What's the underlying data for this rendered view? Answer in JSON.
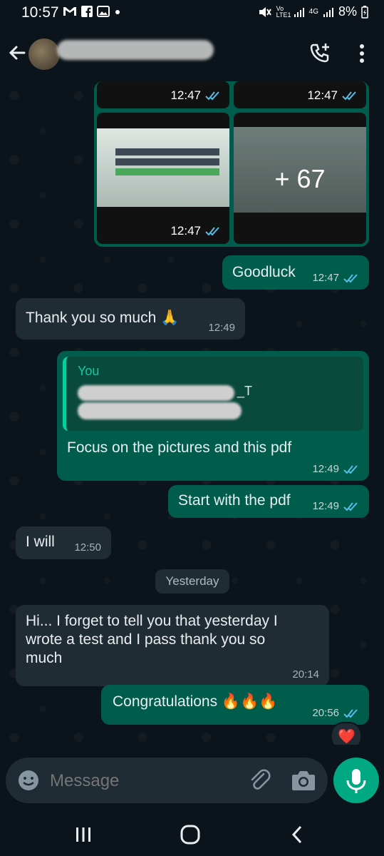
{
  "status_bar": {
    "time": "10:57",
    "network_labels": "Vo LTE1",
    "network_type": "4G",
    "battery": "8%"
  },
  "header": {
    "contact_name": "",
    "icons": [
      "back-arrow-icon",
      "avatar",
      "add-call-icon",
      "more-vert-icon"
    ]
  },
  "album": {
    "times": [
      "12:47",
      "12:47",
      "12:47"
    ],
    "more_count": "+ 67"
  },
  "messages": [
    {
      "id": "goodluck",
      "direction": "out",
      "text": "Goodluck",
      "time": "12:47"
    },
    {
      "id": "thanks",
      "direction": "in",
      "text": "Thank you so much 🙏",
      "time": "12:49"
    },
    {
      "id": "focus",
      "direction": "out",
      "quote_author": "You",
      "quote_tail": "_T",
      "text": "Focus on the pictures and this pdf",
      "time": "12:49"
    },
    {
      "id": "start",
      "direction": "out",
      "text": "Start with the pdf",
      "time": "12:49"
    },
    {
      "id": "iwill",
      "direction": "in",
      "text": "I will",
      "time": "12:50"
    },
    {
      "id": "forget",
      "direction": "in",
      "text": "Hi... I forget to tell you that yesterday I wrote a test and I pass  thank you so much",
      "time": "20:14"
    },
    {
      "id": "congrats",
      "direction": "out",
      "text": "Congratulations 🔥🔥🔥",
      "time": "20:56",
      "reaction": "❤️"
    }
  ],
  "day_separator": "Yesterday",
  "composer": {
    "placeholder": "Message"
  },
  "colors": {
    "outgoing": "#005c4b",
    "incoming": "#202c33",
    "accent": "#00a884",
    "background": "#0b141a"
  }
}
